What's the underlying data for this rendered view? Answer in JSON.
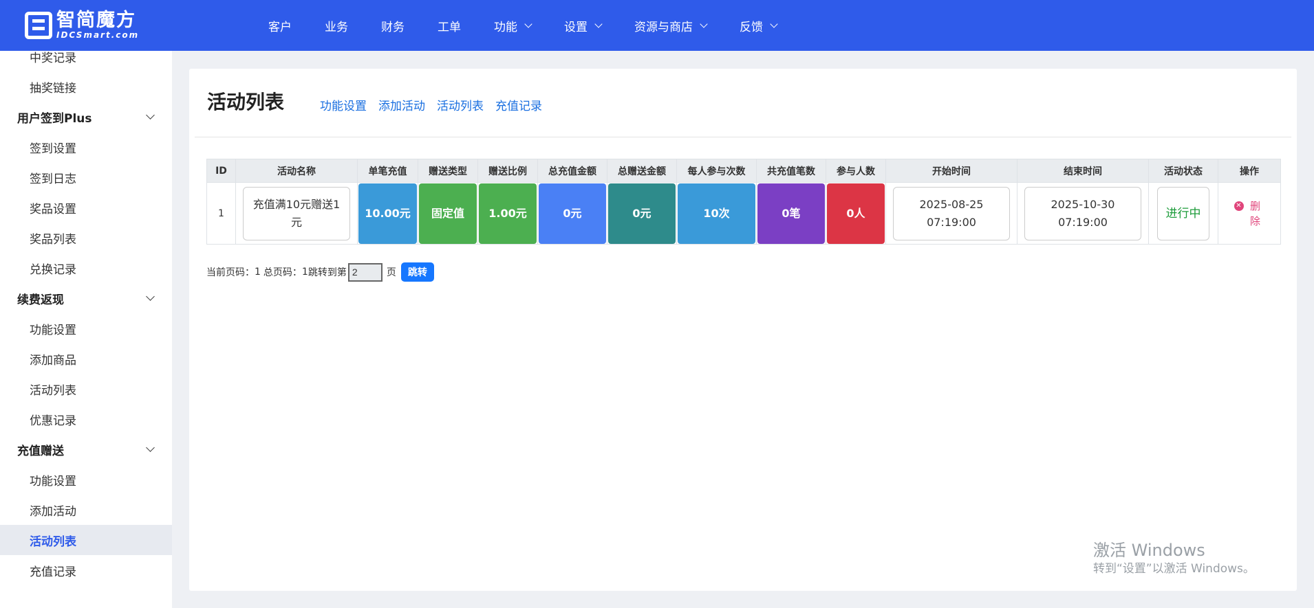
{
  "brand": {
    "name_cn": "智简魔方",
    "name_en": "IDCSmart.com"
  },
  "topnav": [
    {
      "label": "客户",
      "dropdown": false
    },
    {
      "label": "业务",
      "dropdown": false
    },
    {
      "label": "财务",
      "dropdown": false
    },
    {
      "label": "工单",
      "dropdown": false
    },
    {
      "label": "功能",
      "dropdown": true
    },
    {
      "label": "设置",
      "dropdown": true
    },
    {
      "label": "资源与商店",
      "dropdown": true
    },
    {
      "label": "反馈",
      "dropdown": true
    }
  ],
  "sidebar": {
    "items": [
      {
        "type": "item",
        "label": "中奖记录"
      },
      {
        "type": "item",
        "label": "抽奖链接"
      },
      {
        "type": "group",
        "label": "用户签到Plus"
      },
      {
        "type": "item",
        "label": "签到设置"
      },
      {
        "type": "item",
        "label": "签到日志"
      },
      {
        "type": "item",
        "label": "奖品设置"
      },
      {
        "type": "item",
        "label": "奖品列表"
      },
      {
        "type": "item",
        "label": "兑换记录"
      },
      {
        "type": "group",
        "label": "续费返现"
      },
      {
        "type": "item",
        "label": "功能设置"
      },
      {
        "type": "item",
        "label": "添加商品"
      },
      {
        "type": "item",
        "label": "活动列表"
      },
      {
        "type": "item",
        "label": "优惠记录"
      },
      {
        "type": "group",
        "label": "充值赠送"
      },
      {
        "type": "item",
        "label": "功能设置"
      },
      {
        "type": "item",
        "label": "添加活动"
      },
      {
        "type": "item",
        "label": "活动列表",
        "active": true
      },
      {
        "type": "item",
        "label": "充值记录"
      }
    ]
  },
  "page": {
    "title": "活动列表",
    "tabs": [
      "功能设置",
      "添加活动",
      "活动列表",
      "充值记录"
    ]
  },
  "table": {
    "headers": [
      "ID",
      "活动名称",
      "单笔充值",
      "赠送类型",
      "赠送比例",
      "总充值金额",
      "总赠送金额",
      "每人参与次数",
      "共充值笔数",
      "参与人数",
      "开始时间",
      "结束时间",
      "活动状态",
      "操作"
    ],
    "rows": [
      {
        "id": "1",
        "name": "充值满10元赠送1元",
        "single_recharge": "10.00元",
        "gift_type": "固定值",
        "gift_ratio": "1.00元",
        "total_recharge": "0元",
        "total_gift": "0元",
        "per_user_times": "10次",
        "total_count": "0笔",
        "participants": "0人",
        "start_time": "2025-08-25 07:19:00",
        "end_time": "2025-10-30 07:19:00",
        "status": "进行中",
        "action": "删除"
      }
    ]
  },
  "colors": {
    "nav_bg": "#2f5bea",
    "single_recharge": "#3a9ad9",
    "gift_type": "#4caf50",
    "gift_ratio": "#4caf50",
    "total_recharge": "#4a80f5",
    "total_gift": "#2e8b8b",
    "per_user_times": "#3a9ad9",
    "total_count": "#7b3fc4",
    "participants": "#dc3545"
  },
  "pager": {
    "current_label": "当前页码：",
    "current_value": "1",
    "total_label": "总页码：",
    "total_value": "1",
    "jump_prefix": "跳转到第",
    "jump_value": "2",
    "jump_suffix": "页",
    "jump_button": "跳转"
  },
  "watermark": {
    "line1": "激活 Windows",
    "line2": "转到“设置”以激活 Windows。"
  }
}
